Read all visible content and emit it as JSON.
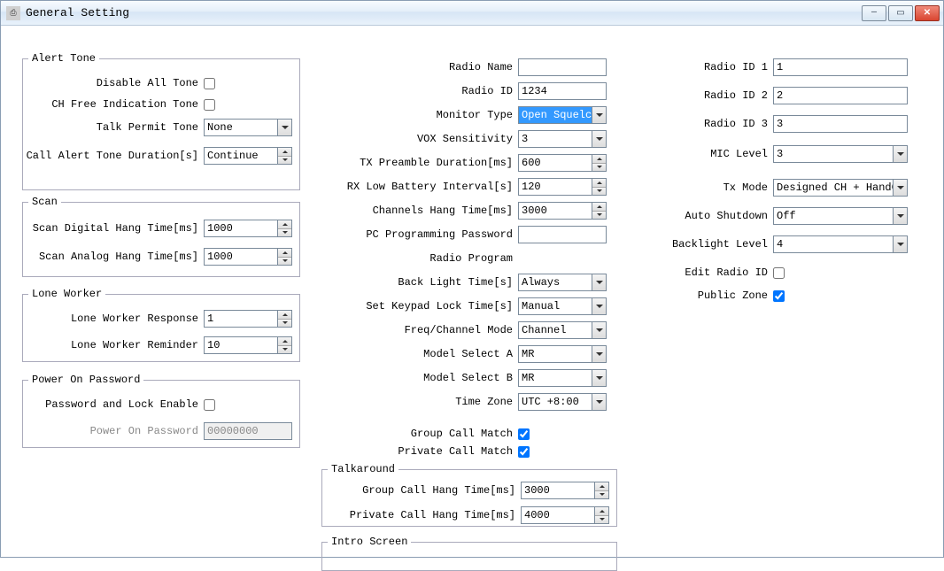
{
  "window": {
    "title": "General Setting"
  },
  "groups": {
    "alert_tone": "Alert Tone",
    "scan": "Scan",
    "lone_worker": "Lone Worker",
    "power_on_password": "Power On Password",
    "talkaround": "Talkaround",
    "intro_screen": "Intro Screen"
  },
  "alert": {
    "disable_all_tone_label": "Disable All Tone",
    "ch_free_indication_tone_label": "CH Free Indication Tone",
    "talk_permit_tone_label": "Talk Permit Tone",
    "talk_permit_tone_value": "None",
    "call_alert_tone_duration_label": "Call Alert Tone Duration[s]",
    "call_alert_tone_duration_value": "Continue"
  },
  "scan": {
    "digital_label": "Scan Digital Hang Time[ms]",
    "digital_value": "1000",
    "analog_label": "Scan Analog Hang Time[ms]",
    "analog_value": "1000"
  },
  "loneworker": {
    "response_label": "Lone Worker Response",
    "response_value": "1",
    "reminder_label": "Lone Worker Reminder",
    "reminder_value": "10"
  },
  "power": {
    "enable_label": "Password and Lock Enable",
    "password_label": "Power On Password",
    "password_value": "00000000"
  },
  "center": {
    "radio_name_label": "Radio Name",
    "radio_name_value": "",
    "radio_id_label": "Radio ID",
    "radio_id_value": "1234",
    "monitor_type_label": "Monitor Type",
    "monitor_type_value": "Open Squelch",
    "vox_sensitivity_label": "VOX Sensitivity",
    "vox_sensitivity_value": "3",
    "tx_preamble_label": "TX Preamble Duration[ms]",
    "tx_preamble_value": "600",
    "rx_low_batt_label": "RX Low Battery Interval[s]",
    "rx_low_batt_value": "120",
    "channels_hang_label": "Channels Hang Time[ms]",
    "channels_hang_value": "3000",
    "pc_prog_pw_label": "PC Programming Password",
    "pc_prog_pw_value": "",
    "radio_program_label": "Radio Program",
    "backlight_time_label": "Back Light Time[s]",
    "backlight_time_value": "Always",
    "keypad_lock_label": "Set Keypad Lock Time[s]",
    "keypad_lock_value": "Manual",
    "freq_channel_label": "Freq/Channel Mode",
    "freq_channel_value": "Channel",
    "model_a_label": "Model Select A",
    "model_a_value": "MR",
    "model_b_label": "Model Select B",
    "model_b_value": "MR",
    "time_zone_label": "Time Zone",
    "time_zone_value": "UTC +8:00",
    "group_call_match_label": "Group Call Match",
    "private_call_match_label": "Private Call Match"
  },
  "talkaround": {
    "group_hang_label": "Group Call Hang Time[ms]",
    "group_hang_value": "3000",
    "private_hang_label": "Private Call Hang Time[ms]",
    "private_hang_value": "4000"
  },
  "right": {
    "radio_id1_label": "Radio ID 1",
    "radio_id1_value": "1",
    "radio_id2_label": "Radio ID 2",
    "radio_id2_value": "2",
    "radio_id3_label": "Radio ID 3",
    "radio_id3_value": "3",
    "mic_level_label": "MIC Level",
    "mic_level_value": "3",
    "tx_mode_label": "Tx Mode",
    "tx_mode_value": "Designed CH + HandCH",
    "auto_shutdown_label": "Auto Shutdown",
    "auto_shutdown_value": "Off",
    "backlight_level_label": "Backlight Level",
    "backlight_level_value": "4",
    "edit_radio_id_label": "Edit Radio ID",
    "public_zone_label": "Public Zone"
  }
}
